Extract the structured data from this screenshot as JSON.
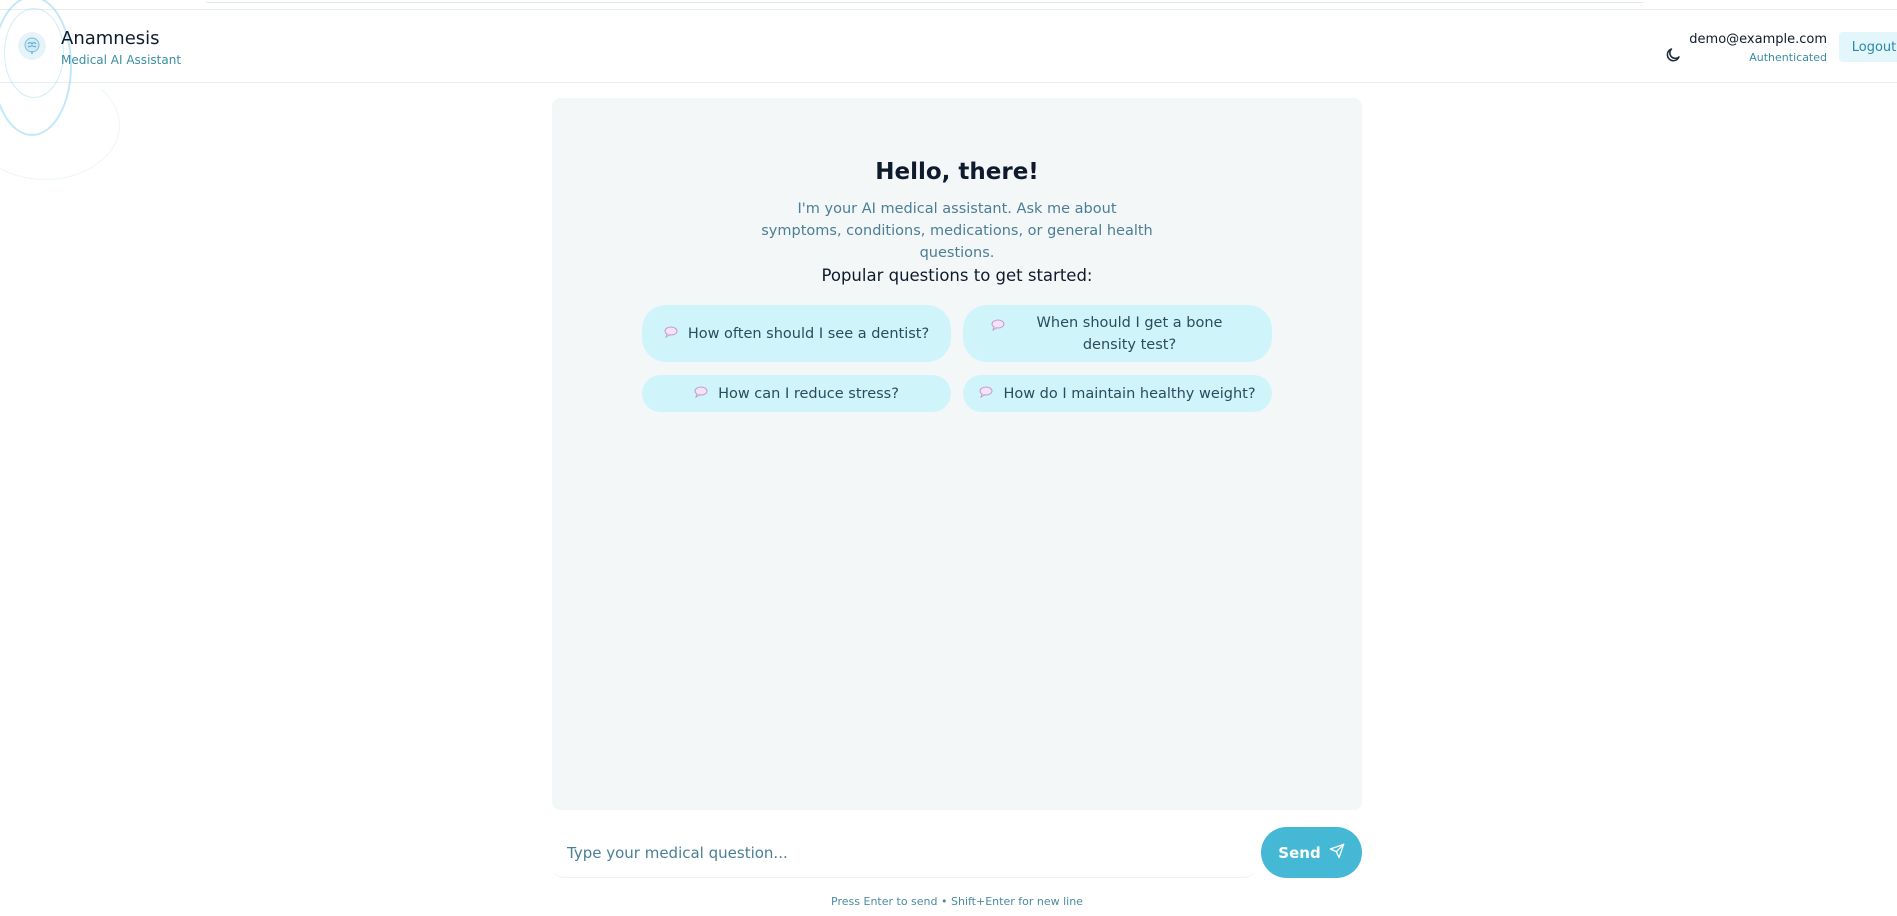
{
  "header": {
    "app_name": "Anamnesis",
    "app_subtitle": "Medical AI Assistant",
    "user_email": "demo@example.com",
    "user_status": "Authenticated",
    "logout_label": "Logout",
    "logo_icon": "brain-icon",
    "theme_icon": "moon-icon"
  },
  "welcome": {
    "greeting": "Hello, there!",
    "intro": "I'm your AI medical assistant. Ask me about symptoms, conditions, medications, or general health questions.",
    "popular_title": "Popular questions to get started:"
  },
  "suggestions": [
    {
      "icon": "speech-bubble-icon",
      "label": "How often should I see a dentist?"
    },
    {
      "icon": "speech-bubble-icon",
      "label": "When should I get a bone density test?"
    },
    {
      "icon": "speech-bubble-icon",
      "label": "How can I reduce stress?"
    },
    {
      "icon": "speech-bubble-icon",
      "label": "How do I maintain healthy weight?"
    }
  ],
  "composer": {
    "placeholder": "Type your medical question...",
    "value": "",
    "send_label": "Send",
    "send_icon": "send-icon",
    "hint": "Press Enter to send • Shift+Enter for new line"
  },
  "colors": {
    "accent": "#45b8d6",
    "chip_bg": "#cff5fb",
    "panel_bg": "#f4f7f8",
    "muted_text": "#4a7f96"
  }
}
